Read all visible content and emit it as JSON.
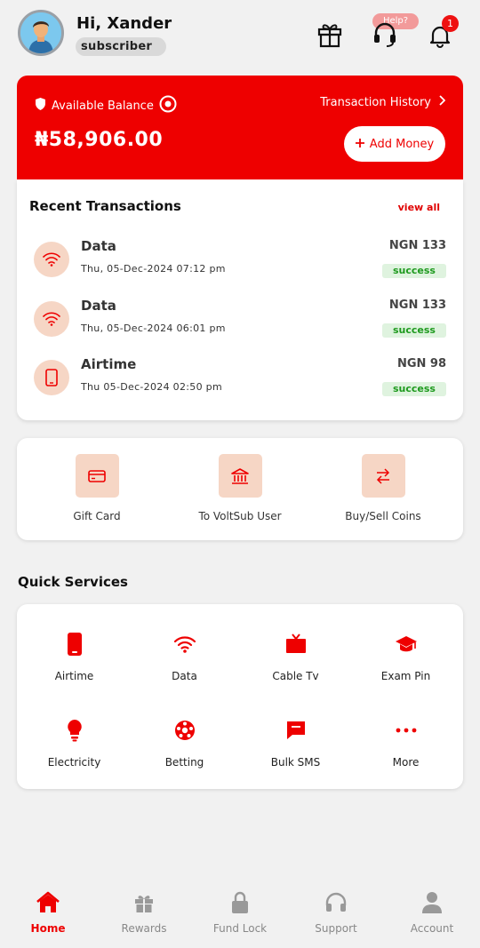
{
  "header": {
    "greeting": "Hi, Xander",
    "role": "subscriber",
    "help_label": "Help?",
    "notification_count": "1"
  },
  "balance": {
    "label": "Available Balance",
    "history_label": "Transaction History",
    "amount": "₦58,906.00",
    "add_money_label": "Add Money",
    "color": "#ee0000"
  },
  "recent": {
    "title": "Recent Transactions",
    "view_all": "view all",
    "items": [
      {
        "icon": "wifi-icon",
        "name": "Data",
        "date": "Thu, 05-Dec-2024 07:12 pm",
        "amount": "NGN 133",
        "status": "success"
      },
      {
        "icon": "wifi-icon",
        "name": "Data",
        "date": "Thu, 05-Dec-2024 06:01 pm",
        "amount": "NGN 133",
        "status": "success"
      },
      {
        "icon": "phone-icon",
        "name": "Airtime",
        "date": "Thu 05-Dec-2024 02:50 pm",
        "amount": "NGN 98",
        "status": "success"
      }
    ]
  },
  "actions": [
    {
      "icon": "card-icon",
      "label": "Gift Card"
    },
    {
      "icon": "bank-icon",
      "label": "To VoltSub User"
    },
    {
      "icon": "swap-icon",
      "label": "Buy/Sell Coins"
    }
  ],
  "quick_services": {
    "title": "Quick Services",
    "items": [
      {
        "icon": "phone-icon",
        "label": "Airtime"
      },
      {
        "icon": "wifi-icon",
        "label": "Data"
      },
      {
        "icon": "tv-icon",
        "label": "Cable Tv"
      },
      {
        "icon": "graduation-cap-icon",
        "label": "Exam Pin"
      },
      {
        "icon": "bulb-icon",
        "label": "Electricity"
      },
      {
        "icon": "ball-icon",
        "label": "Betting"
      },
      {
        "icon": "message-icon",
        "label": "Bulk SMS"
      },
      {
        "icon": "more-icon",
        "label": "More"
      }
    ]
  },
  "nav": [
    {
      "icon": "home-icon",
      "label": "Home",
      "active": true
    },
    {
      "icon": "gift-icon",
      "label": "Rewards",
      "active": false
    },
    {
      "icon": "lock-icon",
      "label": "Fund Lock",
      "active": false
    },
    {
      "icon": "headset-icon",
      "label": "Support",
      "active": false
    },
    {
      "icon": "user-icon",
      "label": "Account",
      "active": false
    }
  ]
}
